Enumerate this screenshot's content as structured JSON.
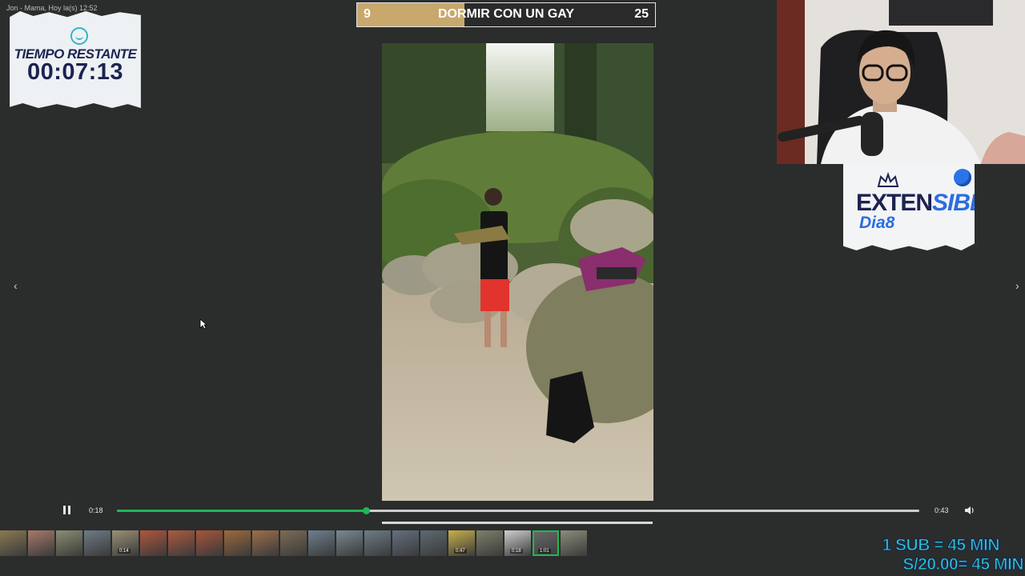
{
  "app_label": "Jon - Mama, Hoy  la(s) 12:52",
  "timer": {
    "title": "TIEMPO RESTANTE",
    "value": "00:07:13"
  },
  "scoreboard": {
    "left_score": "9",
    "title": "DORMIR CON UN GAY",
    "right_score": "25",
    "left_fraction": 0.36,
    "fill_color": "#c8a86c"
  },
  "sticker": {
    "line1_a": "EXTEN",
    "line1_b": "SIBLE",
    "line2": "Dia8"
  },
  "navigation": {
    "prev_icon": "chevron-left-icon",
    "next_icon": "chevron-right-icon"
  },
  "player": {
    "current_time": "0:18",
    "total_time": "0:43",
    "progress": 0.31,
    "accent_color": "#1fb856"
  },
  "thumbnails": [
    {
      "label": "",
      "color": "#8a7a52"
    },
    {
      "label": "",
      "color": "#a77a6a"
    },
    {
      "label": "",
      "color": "#8b8e72"
    },
    {
      "label": "",
      "color": "#6e7b86"
    },
    {
      "label": "0:14",
      "color": "#9a9076"
    },
    {
      "label": "",
      "color": "#b0563e"
    },
    {
      "label": "",
      "color": "#ad5a40"
    },
    {
      "label": "",
      "color": "#a8553b"
    },
    {
      "label": "",
      "color": "#9e6a3c"
    },
    {
      "label": "",
      "color": "#9d6f4a"
    },
    {
      "label": "",
      "color": "#7c6c56"
    },
    {
      "label": "",
      "color": "#6e7f8e"
    },
    {
      "label": "",
      "color": "#7a8a90"
    },
    {
      "label": "",
      "color": "#6d7d86"
    },
    {
      "label": "",
      "color": "#667080"
    },
    {
      "label": "",
      "color": "#5e6a70"
    },
    {
      "label": "0:47",
      "color": "#c8b04a"
    },
    {
      "label": "",
      "color": "#7e806a"
    },
    {
      "label": "0:18",
      "color": "#cfcfcf"
    },
    {
      "label": "1:01",
      "color": "#6b6b6b",
      "active": true
    },
    {
      "label": "",
      "color": "#8a8e7a"
    }
  ],
  "promo": {
    "line1": "1 SUB = 45 MIN",
    "line2": "S/20.00= 45 MIN"
  }
}
